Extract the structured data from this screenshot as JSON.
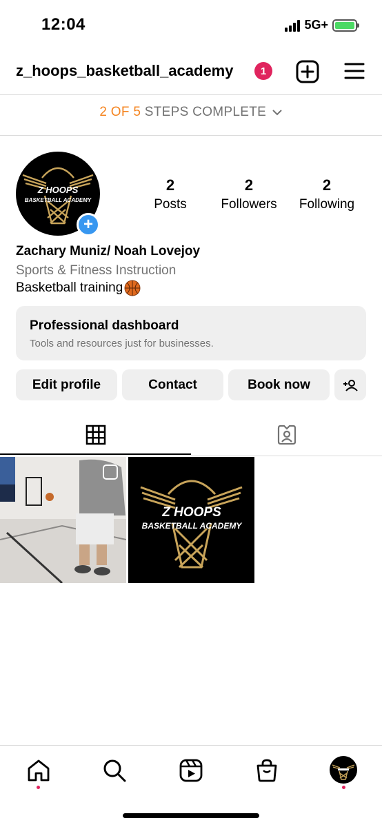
{
  "status_bar": {
    "time": "12:04",
    "network": "5G+"
  },
  "header": {
    "username": "z_hoops_basketball_academy",
    "notification_count": "1"
  },
  "steps": {
    "progress": "2 OF 5",
    "suffix": "STEPS COMPLETE"
  },
  "profile": {
    "logo_text_line1": "Z HOOPS",
    "logo_text_line2": "BASKETBALL ACADEMY",
    "stats": [
      {
        "value": "2",
        "label": "Posts"
      },
      {
        "value": "2",
        "label": "Followers"
      },
      {
        "value": "2",
        "label": "Following"
      }
    ],
    "display_name": "Zachary Muniz/ Noah Lovejoy",
    "category": "Sports & Fitness Instruction",
    "bio": "Basketball training"
  },
  "dashboard": {
    "title": "Professional dashboard",
    "subtitle": "Tools and resources just for businesses."
  },
  "actions": {
    "edit_profile": "Edit profile",
    "contact": "Contact",
    "book_now": "Book now"
  },
  "colors": {
    "accent_orange": "#f5841f",
    "badge_red": "#e0245e",
    "plus_blue": "#3897f0",
    "logo_gold": "#c8a45a"
  },
  "icons": [
    "new-post-icon",
    "menu-icon",
    "chevron-down-icon",
    "add-person-icon",
    "grid-icon",
    "tagged-icon",
    "home-icon",
    "search-icon",
    "reels-icon",
    "shop-icon"
  ]
}
